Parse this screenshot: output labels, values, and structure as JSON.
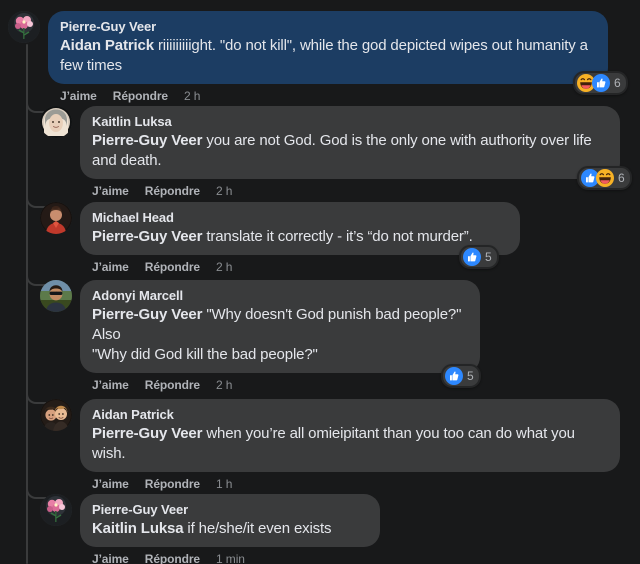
{
  "theme": {
    "page_background": "#18191a",
    "bubble_grey": "#3a3b3c",
    "bubble_blue": "#1c3d63",
    "text_primary": "#e4e6eb",
    "text_secondary": "#b0b3b8",
    "reaction_like_blue": "#2d88ff",
    "reaction_haha_yellow": "#f7b125",
    "thread_line": "#3a3b3c"
  },
  "actions": {
    "like_label": "J’aime",
    "reply_label": "Répondre"
  },
  "comments": [
    {
      "id": "c1",
      "level": "root",
      "author": "Pierre-Guy Veer",
      "avatar_icon": "flower-bouquet-avatar",
      "mention": "Aidan Patrick",
      "text": " riiiiiiiiight. \"do not kill\", while the god depicted wipes out humanity a few times",
      "bubble_style": "blue",
      "timestamp": "2 h",
      "reactions": {
        "icons": [
          "haha-reaction-icon",
          "like-reaction-icon"
        ],
        "count": "6"
      }
    },
    {
      "id": "c2",
      "level": "reply",
      "author": "Kaitlin Luksa",
      "avatar_icon": "woman-portrait-avatar",
      "mention": "Pierre-Guy Veer",
      "text": " you are not God. God is the only one with authority over life and death.",
      "bubble_style": "grey",
      "timestamp": "2 h",
      "reactions": {
        "icons": [
          "like-reaction-icon",
          "haha-reaction-icon"
        ],
        "count": "6"
      }
    },
    {
      "id": "c3",
      "level": "reply",
      "author": "Michael Head",
      "avatar_icon": "person-red-jacket-avatar",
      "mention": "Pierre-Guy Veer",
      "text": " translate it correctly - it’s “do not murder”.",
      "bubble_style": "grey",
      "timestamp": "2 h",
      "reactions": {
        "icons": [
          "like-reaction-icon"
        ],
        "count": "5"
      }
    },
    {
      "id": "c4",
      "level": "reply",
      "author": "Adonyi Marcell",
      "avatar_icon": "man-sunglasses-avatar",
      "mention": "Pierre-Guy Veer",
      "text": " \"Why doesn't God punish bad people?\"\nAlso\n\"Why did God kill the bad people?\"",
      "bubble_style": "grey",
      "timestamp": "2 h",
      "reactions": {
        "icons": [
          "like-reaction-icon"
        ],
        "count": "5"
      }
    },
    {
      "id": "c5",
      "level": "reply",
      "author": "Aidan Patrick",
      "avatar_icon": "two-people-avatar",
      "mention": "Pierre-Guy Veer",
      "text": " when you’re all omieipitant than you too can do what you wish.",
      "bubble_style": "grey",
      "timestamp": "1 h",
      "reactions": null
    },
    {
      "id": "c6",
      "level": "reply",
      "author": "Pierre-Guy Veer",
      "avatar_icon": "flower-bouquet-avatar",
      "mention": "Kaitlin Luksa",
      "text": " if he/she/it even exists",
      "bubble_style": "grey",
      "timestamp": "1 min",
      "reactions": null
    }
  ]
}
